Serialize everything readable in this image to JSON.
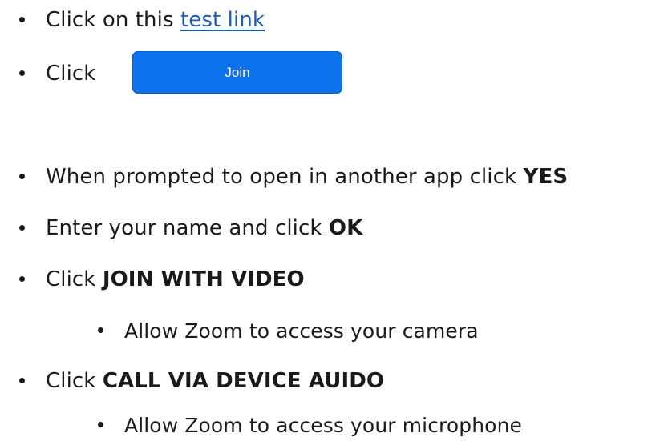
{
  "steps": [
    {
      "prefix": "Click on this ",
      "link_text": "test link"
    },
    {
      "prefix": "Click",
      "button_label": "Join"
    },
    {
      "prefix": "When prompted to open in another app click ",
      "bold": "YES"
    },
    {
      "prefix": "Enter your name and click ",
      "bold": "OK"
    },
    {
      "prefix": "Click ",
      "bold": "JOIN WITH VIDEO"
    },
    {
      "text": "Allow Zoom to access your camera"
    },
    {
      "prefix": "Click ",
      "bold": "CALL VIA DEVICE AUIDO"
    },
    {
      "text": "Allow Zoom to access your microphone"
    }
  ]
}
